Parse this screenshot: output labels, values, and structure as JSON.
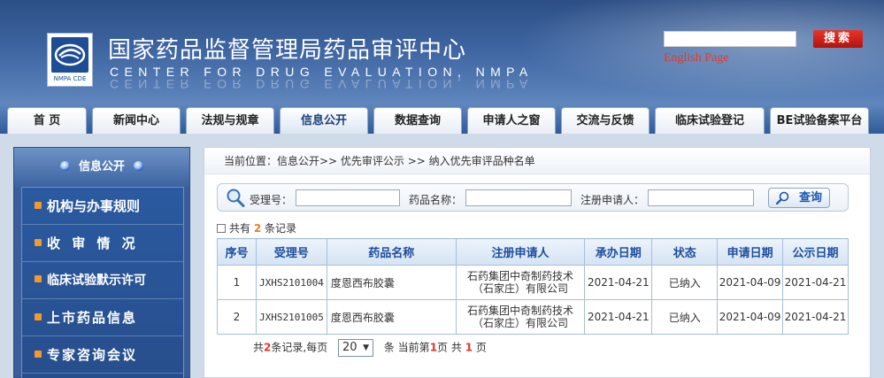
{
  "header": {
    "title": "国家药品监督管理局药品审评中心",
    "subtitle": "CENTER FOR DRUG EVALUATION, NMPA",
    "logo_tag": "NMPA CDE",
    "search_value": "",
    "search_button": "搜索",
    "english_link": "English Page"
  },
  "nav": {
    "tabs": [
      {
        "label": "首 页"
      },
      {
        "label": "新闻中心"
      },
      {
        "label": "法规与规章"
      },
      {
        "label": "信息公开"
      },
      {
        "label": "数据查询"
      },
      {
        "label": "申请人之窗"
      },
      {
        "label": "交流与反馈"
      },
      {
        "label": "临床试验登记"
      },
      {
        "label": "BE试验备案平台"
      }
    ],
    "active": "信息公开"
  },
  "sidebar": {
    "heading": "信息公开",
    "items": [
      {
        "label": "机构与办事规则"
      },
      {
        "label": "收 审 情 况"
      },
      {
        "label": "临床试验默示许可"
      },
      {
        "label": "上市药品信息"
      },
      {
        "label": "专家咨询会议"
      }
    ]
  },
  "main": {
    "breadcrumb": "当前位置：信息公开>> 优先审评公示 >> 纳入优先审评品种名单",
    "search": {
      "accept_label": "受理号：",
      "drug_label": "药品名称：",
      "applicant_label": "注册申请人：",
      "accept_value": "",
      "drug_value": "",
      "applicant_value": "",
      "button": "查询"
    },
    "count": {
      "prefix": "共有",
      "value": "2",
      "suffix": "条记录"
    },
    "table": {
      "headers": [
        "序号",
        "受理号",
        "药品名称",
        "注册申请人",
        "承办日期",
        "状态",
        "申请日期",
        "公示日期"
      ],
      "rows": [
        {
          "no": "1",
          "code": "JXHS2101004",
          "name": "度恩西布胶囊",
          "applicant_1": "石药集团中奇制药技术",
          "applicant_2": "（石家庄）有限公司",
          "handle_date": "2021-04-21",
          "status": "已纳入",
          "apply_date": "2021-04-09",
          "publish_date": "2021-04-21"
        },
        {
          "no": "2",
          "code": "JXHS2101005",
          "name": "度恩西布胶囊",
          "applicant_1": "石药集团中奇制药技术",
          "applicant_2": "（石家庄）有限公司",
          "handle_date": "2021-04-21",
          "status": "已纳入",
          "apply_date": "2021-04-09",
          "publish_date": "2021-04-21"
        }
      ]
    },
    "pager": {
      "total_prefix": "共",
      "total": "2",
      "total_suffix": "条记录,每页",
      "page_size": "20",
      "page_prefix": "条 当前第",
      "current": "1",
      "page_mid": "页 共",
      "pages": "1",
      "page_suffix": "页"
    }
  },
  "colors": {
    "brand_blue": "#2d4f86",
    "accent_red": "#e5322a",
    "count_orange": "#e8801e"
  }
}
